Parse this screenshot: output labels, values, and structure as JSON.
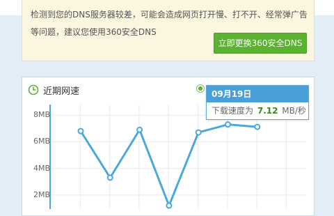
{
  "notice": {
    "message": "检测到您的DNS服务器较差，可能会造成网页打开慢、打不开、经常弹广告等问题，建议您使用360安全DNS",
    "button_label": "立即更换360安全DNS"
  },
  "panel": {
    "title": "近期网速"
  },
  "tooltip": {
    "date": "09月19日",
    "prefix": "下载速度为",
    "value": "7.12",
    "unit": "MB/秒"
  },
  "colors": {
    "accent_green": "#5ab230",
    "line_blue": "#4aa8dc",
    "notice_bg": "#fbf6df"
  },
  "chart_data": {
    "type": "line",
    "y_ticks": [
      "8MB",
      "6MB",
      "4MB",
      "2MB"
    ],
    "ylim": [
      0,
      8.8
    ],
    "grid": true,
    "series": [
      {
        "values": [
          6.8,
          3.3,
          6.9,
          1.2,
          6.7,
          7.3,
          7.12
        ]
      }
    ]
  }
}
